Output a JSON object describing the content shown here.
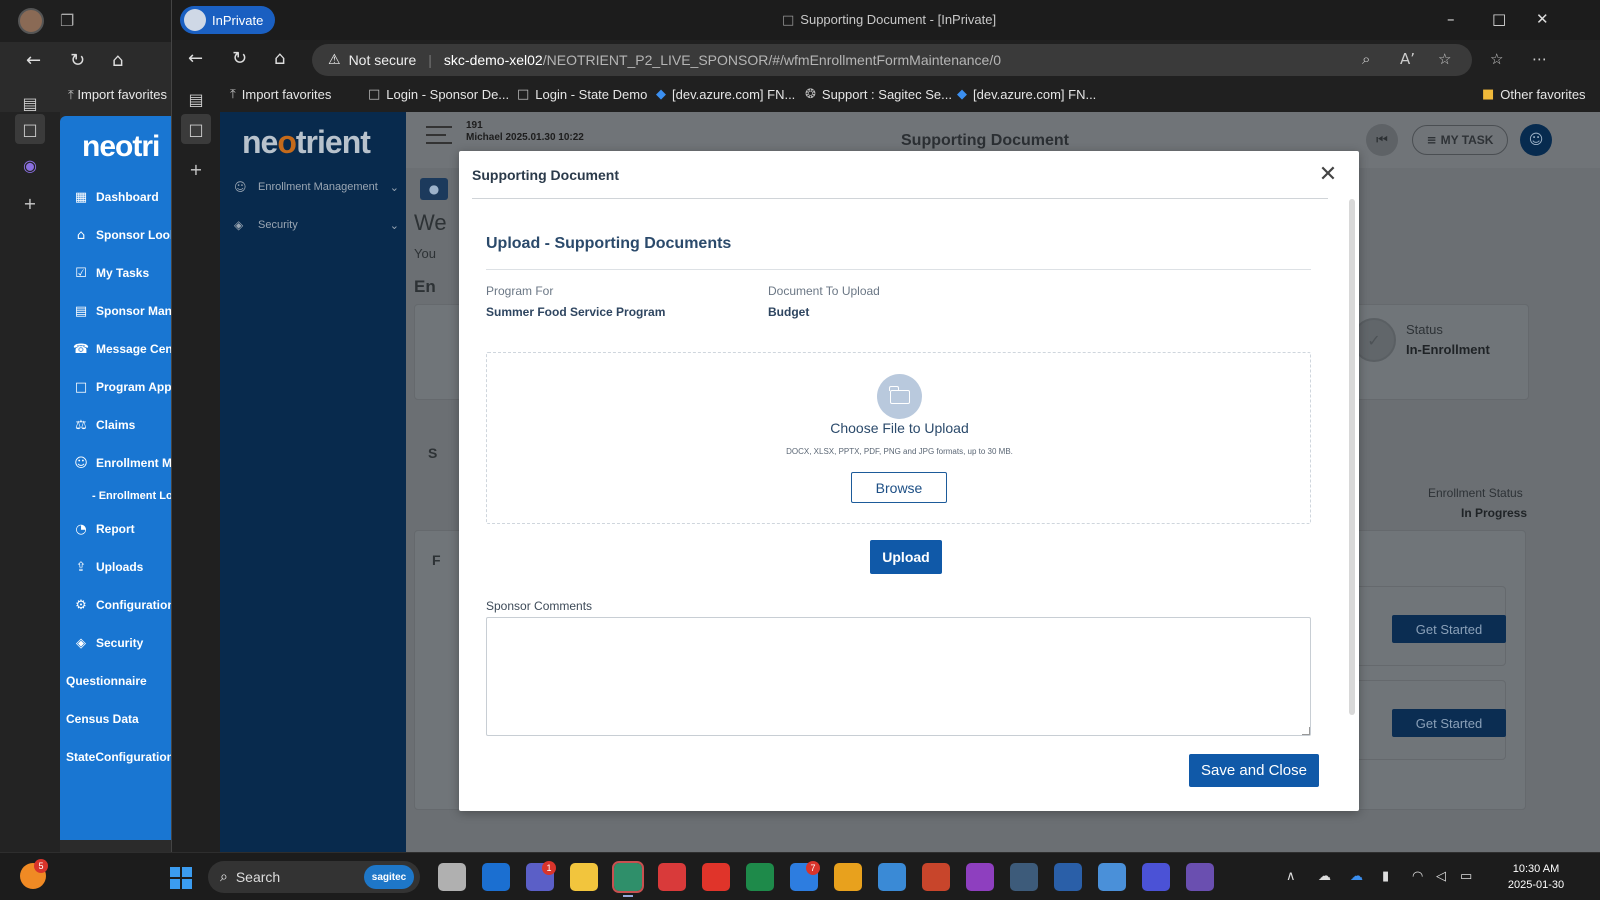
{
  "background_browser": {
    "favorites": {
      "import_label": "Import favorites"
    },
    "sidebar": {
      "logo": "neotri",
      "items": [
        {
          "label": "Dashboard",
          "icon": "grid-icon"
        },
        {
          "label": "Sponsor Looku",
          "icon": "bank-icon"
        },
        {
          "label": "My Tasks",
          "icon": "tasks-icon"
        },
        {
          "label": "Sponsor Manag",
          "icon": "manage-icon"
        },
        {
          "label": "Message Cente",
          "icon": "phone-icon"
        },
        {
          "label": "Program Applic",
          "icon": "document-icon"
        },
        {
          "label": "Claims",
          "icon": "claims-icon"
        },
        {
          "label": "Enrollment Mar",
          "icon": "person-icon"
        },
        {
          "label": "- Enrollment Lo",
          "icon": ""
        },
        {
          "label": "Report",
          "icon": "report-icon"
        },
        {
          "label": "Uploads",
          "icon": "upload-icon"
        },
        {
          "label": "Configurations",
          "icon": "gear-icon"
        },
        {
          "label": "Security",
          "icon": "shield-icon"
        },
        {
          "label": "Questionnaire",
          "icon": ""
        },
        {
          "label": "Census Data",
          "icon": ""
        },
        {
          "label": "StateConfiguration",
          "icon": ""
        }
      ]
    }
  },
  "browser": {
    "inprivate_label": "InPrivate",
    "window_title": "Supporting Document - [InPrivate]",
    "address": {
      "security_label": "Not secure",
      "host": "skc-demo-xel02",
      "path": "/NEOTRIENT_P2_LIVE_SPONSOR/#/wfmEnrollmentFormMaintenance/0"
    },
    "favorites": [
      {
        "label": "Import favorites",
        "icon": "import-icon"
      },
      {
        "label": "Login - Sponsor De...",
        "icon": "page-icon"
      },
      {
        "label": "Login - State Demo",
        "icon": "page-icon"
      },
      {
        "label": "[dev.azure.com] FN...",
        "icon": "azure-icon"
      },
      {
        "label": "Support : Sagitec Se...",
        "icon": "support-icon"
      },
      {
        "label": "[dev.azure.com] FN...",
        "icon": "azure-icon"
      }
    ],
    "other_favorites": "Other favorites"
  },
  "app": {
    "logo_pre": "ne",
    "logo_o": "o",
    "logo_post": "trient",
    "sidebar": [
      {
        "label": "Enrollment Management",
        "icon": "person-icon"
      },
      {
        "label": "Security",
        "icon": "shield-icon"
      }
    ],
    "header": {
      "line1": "191",
      "line2": "Michael 2025.01.30 10:22",
      "title": "Supporting Document",
      "mytask_label": "MY TASK"
    },
    "background": {
      "welcome_fragment": "We",
      "you_fragment": "You",
      "en_fragment": "En",
      "s_fragment": "S",
      "f_fragment": "F",
      "status_label": "Status",
      "status_value": "In-Enrollment",
      "enrollment_status_label": "Enrollment Status",
      "enrollment_status_value": "In Progress",
      "get_started_1": "Get Started",
      "get_started_2": "Get Started"
    }
  },
  "modal": {
    "title": "Supporting Document",
    "section_title": "Upload - Supporting Documents",
    "program_for_label": "Program For",
    "program_for_value": "Summer Food Service Program",
    "document_label": "Document To Upload",
    "document_value": "Budget",
    "dropzone_title": "Choose File to Upload",
    "dropzone_subtitle": "DOCX, XLSX, PPTX, PDF, PNG and JPG formats, up to 30 MB.",
    "browse_label": "Browse",
    "upload_label": "Upload",
    "comments_label": "Sponsor Comments",
    "comments_value": "",
    "save_label": "Save and Close"
  },
  "taskbar": {
    "weather_badge": "5",
    "search_label": "Search",
    "search_pill": "sagitec",
    "teams_badge": "1",
    "todo_badge": "7",
    "clock_time": "10:30 AM",
    "clock_date": "2025-01-30"
  }
}
